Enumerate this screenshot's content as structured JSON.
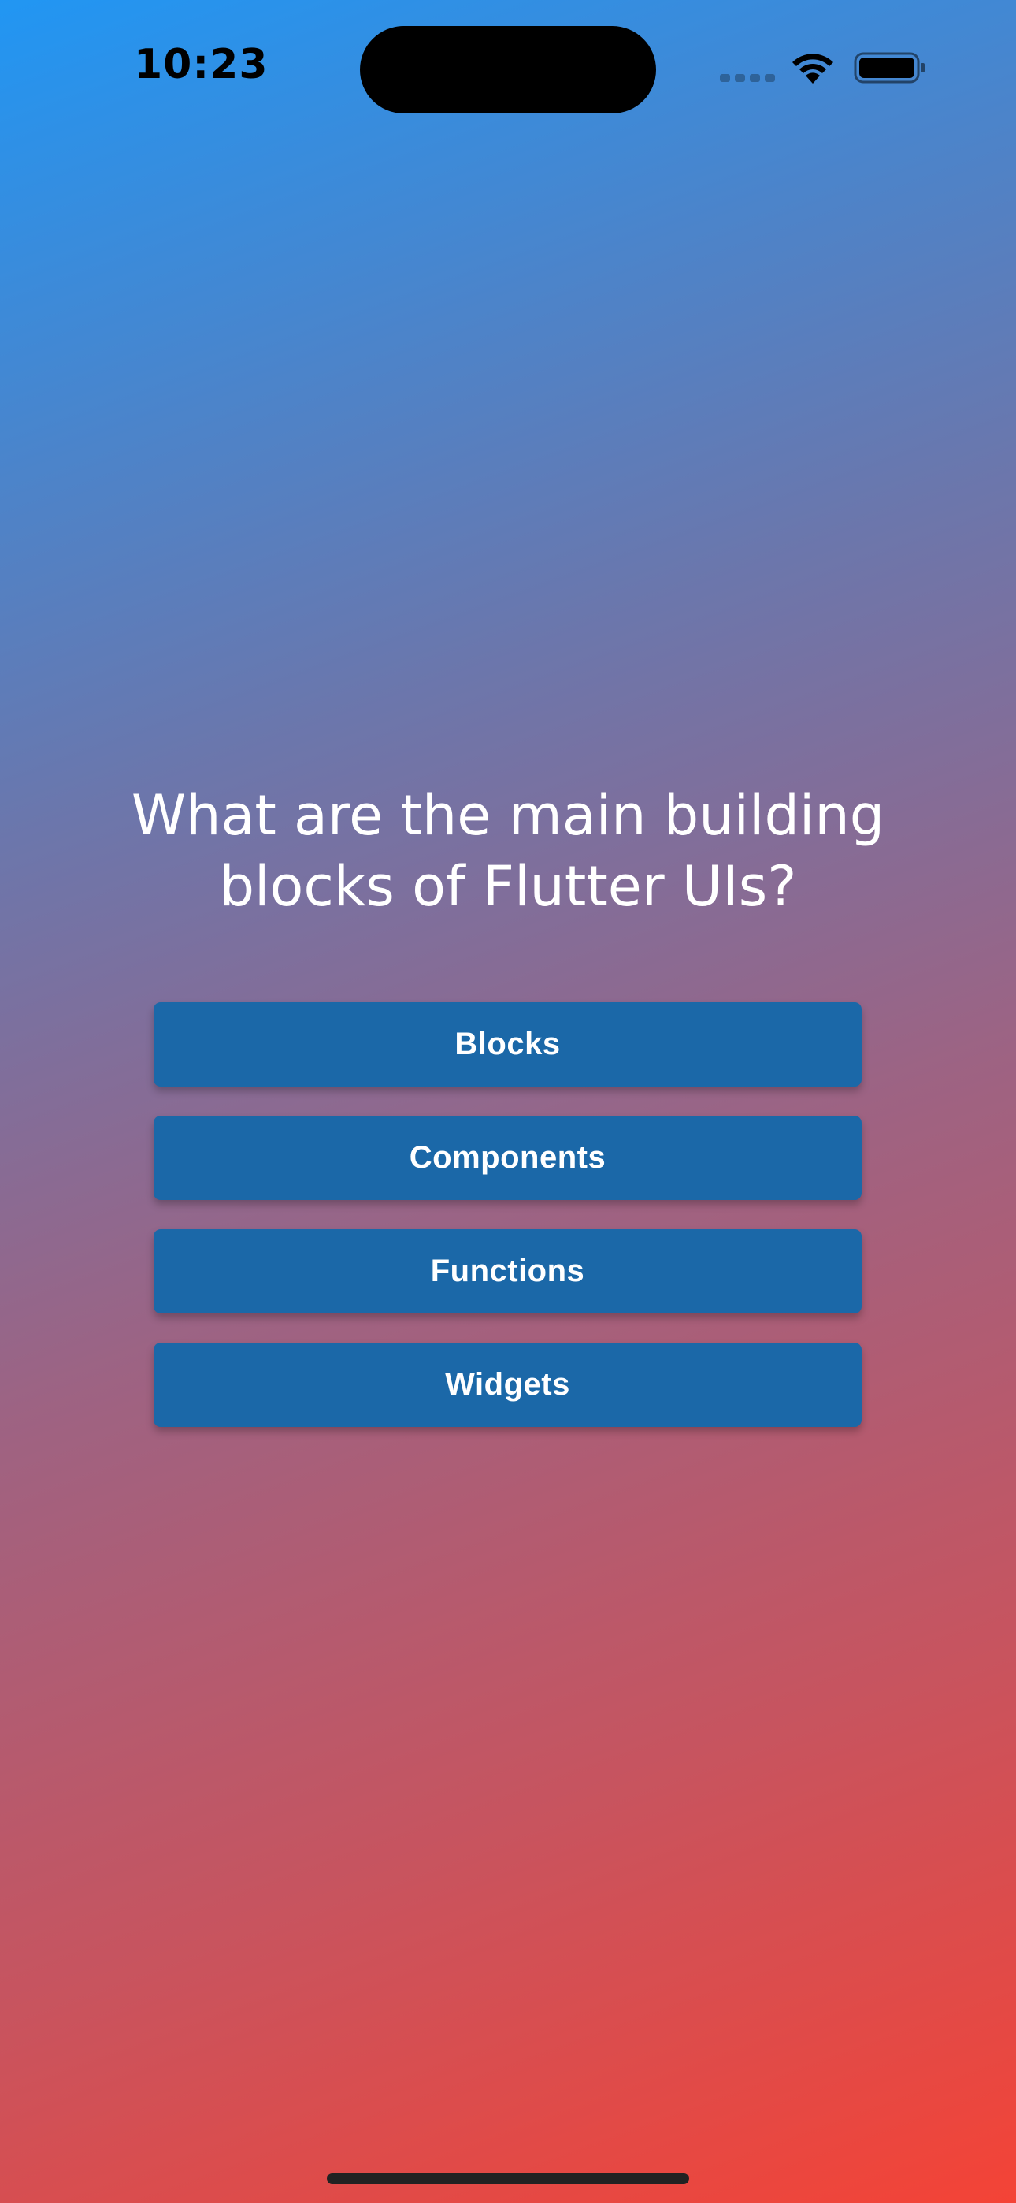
{
  "status_bar": {
    "time": "10:23",
    "icons": [
      "signal-icon",
      "wifi-icon",
      "battery-icon"
    ]
  },
  "quiz": {
    "question": "What are the main building blocks of Flutter UIs?",
    "answers": [
      "Blocks",
      "Components",
      "Functions",
      "Widgets"
    ]
  },
  "colors": {
    "gradient_start": "#2196f3",
    "gradient_end": "#f44336",
    "button_bg": "#1b68a8",
    "text": "#ffffff"
  }
}
